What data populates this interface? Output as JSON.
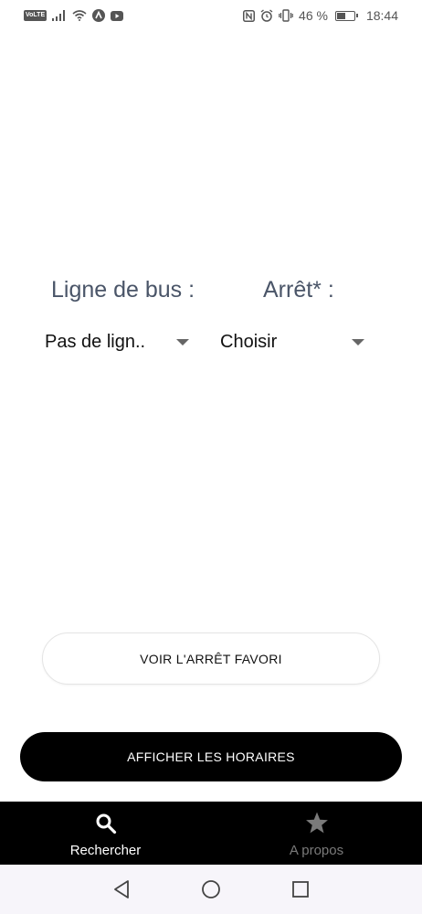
{
  "status_bar": {
    "volte": "VoLTE",
    "battery_percent_text": "46 %",
    "battery_level": 0.46,
    "time": "18:44",
    "left_icons": [
      "signal-icon",
      "wifi-icon",
      "nav-app-icon",
      "youtube-icon"
    ],
    "right_icons": [
      "nfc-icon",
      "alarm-icon",
      "vibrate-icon",
      "battery-icon"
    ]
  },
  "form": {
    "ligne_label": "Ligne de bus :",
    "arret_label": "Arrêt* :",
    "ligne_value": "Pas de lign..",
    "arret_value": "Choisir"
  },
  "buttons": {
    "favori": "VOIR L'ARRÊT FAVORI",
    "horaires": "AFFICHER LES HORAIRES"
  },
  "tabs": [
    {
      "label": "Rechercher",
      "icon": "search-icon",
      "active": true
    },
    {
      "label": "A propos",
      "icon": "star-icon",
      "active": false
    }
  ],
  "nav": [
    "back-icon",
    "home-icon",
    "recents-icon"
  ]
}
